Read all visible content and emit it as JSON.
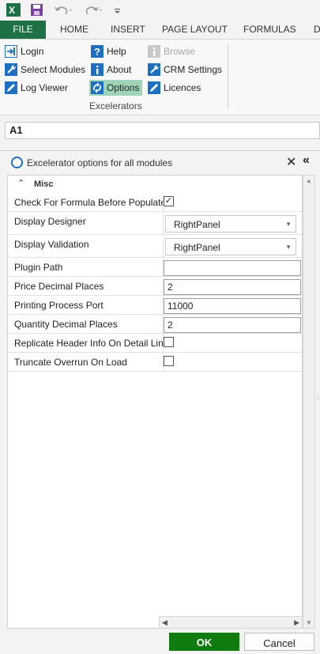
{
  "qat": {
    "excel_icon": "excel-icon",
    "save_icon": "save-icon",
    "undo_icon": "undo-icon",
    "redo_icon": "redo-icon",
    "customize_icon": "customize-icon"
  },
  "tabs": [
    {
      "label": "FILE"
    },
    {
      "label": "HOME"
    },
    {
      "label": "INSERT"
    },
    {
      "label": "PAGE LAYOUT"
    },
    {
      "label": "FORMULAS"
    },
    {
      "label": "D"
    }
  ],
  "ribbon": {
    "col1": [
      {
        "label": "Login",
        "icon": "login-icon"
      },
      {
        "label": "Select Modules",
        "icon": "wrench-icon"
      },
      {
        "label": "Log Viewer",
        "icon": "pencil-icon"
      }
    ],
    "col2": [
      {
        "label": "Help",
        "icon": "help-icon"
      },
      {
        "label": "About",
        "icon": "info-icon"
      },
      {
        "label": "Options",
        "icon": "options-icon"
      }
    ],
    "col3": [
      {
        "label": "Browse",
        "icon": "browse-icon"
      },
      {
        "label": "CRM Settings",
        "icon": "wrench-icon"
      },
      {
        "label": "Licences",
        "icon": "pencil-icon"
      }
    ],
    "group_label": "Excelerators"
  },
  "namebox": {
    "value": "A1"
  },
  "panel": {
    "title": "Excelerator options for all modules",
    "close_symbol": "✕",
    "collapse_symbol": "«"
  },
  "grid": {
    "category": "Misc",
    "rows": [
      {
        "name": "Check For Formula Before Populate",
        "type": "checkbox",
        "checked": true,
        "mark": "✓"
      },
      {
        "name": "Display Designer",
        "type": "dropdown",
        "value": "RightPanel"
      },
      {
        "name": "Display Validation",
        "type": "dropdown",
        "value": "RightPanel"
      },
      {
        "name": "Plugin Path",
        "type": "text",
        "value": ""
      },
      {
        "name": "Price Decimal Places",
        "type": "text",
        "value": "2"
      },
      {
        "name": "Printing Process Port",
        "type": "text",
        "value": "11000"
      },
      {
        "name": "Quantity Decimal Places",
        "type": "text",
        "value": "2"
      },
      {
        "name": "Replicate Header Info On Detail Lines",
        "type": "checkbox",
        "checked": false,
        "mark": ""
      },
      {
        "name": "Truncate Overrun On Load",
        "type": "checkbox",
        "checked": false,
        "mark": ""
      }
    ]
  },
  "footer": {
    "ok": "OK",
    "cancel": "Cancel"
  },
  "colors": {
    "file_tab": "#1e7145",
    "ok_button": "#107c10",
    "active_option": "#9fd5b7",
    "radio": "#1d6fc2"
  }
}
